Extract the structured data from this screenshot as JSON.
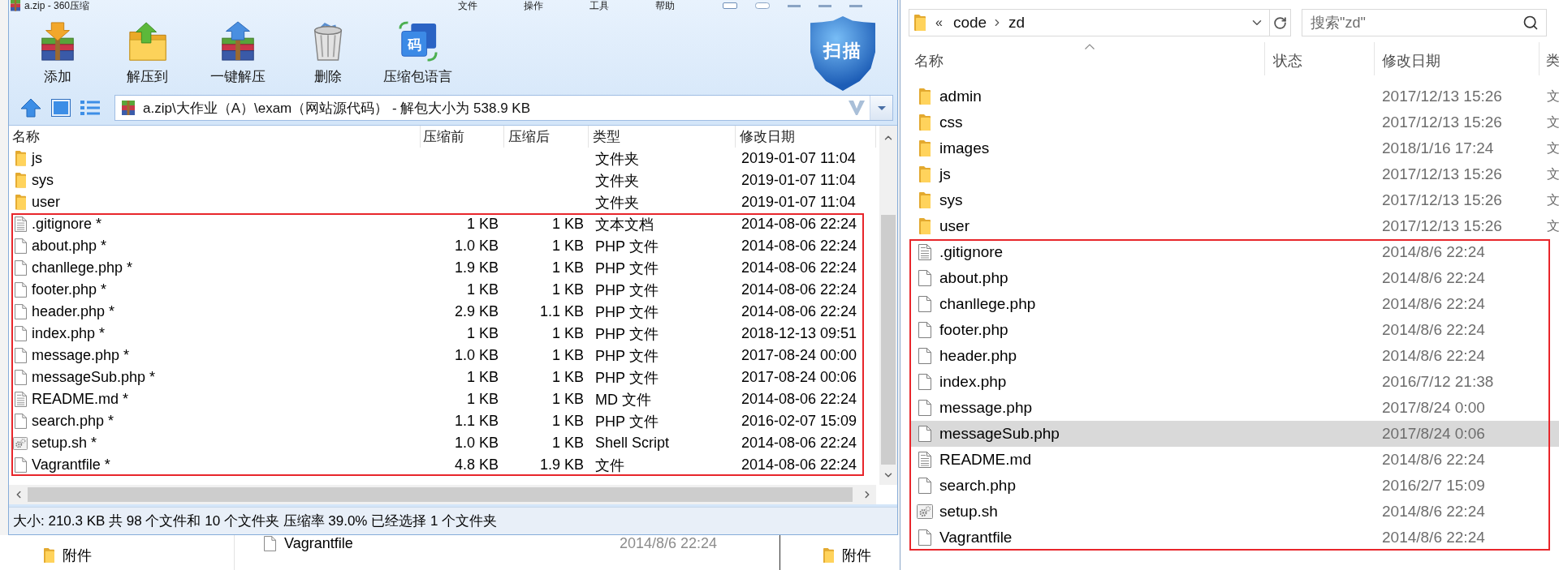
{
  "archive_window": {
    "title": "a.zip - 360压缩",
    "menu": [
      "文件",
      "操作",
      "工具",
      "帮助"
    ],
    "toolbar": [
      {
        "kind": "add",
        "label": "添加"
      },
      {
        "kind": "extract_to",
        "label": "解压到"
      },
      {
        "kind": "quick_extract",
        "label": "一键解压"
      },
      {
        "kind": "delete",
        "label": "删除"
      },
      {
        "kind": "language",
        "label": "压缩包语言",
        "glyph": "码"
      }
    ],
    "scan_button": {
      "label": "扫描"
    },
    "address": "a.zip\\大作业（A）\\exam（网站源代码） - 解包大小为 538.9 KB",
    "columns": [
      "名称",
      "压缩前",
      "压缩后",
      "类型",
      "修改日期"
    ],
    "rows": [
      {
        "kind": "folder",
        "name": "js",
        "type": "文件夹",
        "modified": "2019-01-07 11:04",
        "highlighted": false,
        "selected": false
      },
      {
        "kind": "folder",
        "name": "sys",
        "type": "文件夹",
        "modified": "2019-01-07 11:04",
        "highlighted": false,
        "selected": false
      },
      {
        "kind": "folder",
        "name": "user",
        "type": "文件夹",
        "modified": "2019-01-07 11:04",
        "highlighted": false,
        "selected": false
      },
      {
        "kind": "text",
        "name": ".gitignore *",
        "size": "1 KB",
        "packed": "1 KB",
        "type": "文本文档",
        "modified": "2014-08-06 22:24",
        "highlighted": true,
        "selected": false
      },
      {
        "kind": "file",
        "name": "about.php *",
        "size": "1.0 KB",
        "packed": "1 KB",
        "type": "PHP 文件",
        "modified": "2014-08-06 22:24",
        "highlighted": true,
        "selected": false
      },
      {
        "kind": "file",
        "name": "chanllege.php *",
        "size": "1.9 KB",
        "packed": "1 KB",
        "type": "PHP 文件",
        "modified": "2014-08-06 22:24",
        "highlighted": true,
        "selected": false
      },
      {
        "kind": "file",
        "name": "footer.php *",
        "size": "1 KB",
        "packed": "1 KB",
        "type": "PHP 文件",
        "modified": "2014-08-06 22:24",
        "highlighted": true,
        "selected": false
      },
      {
        "kind": "file",
        "name": "header.php *",
        "size": "2.9 KB",
        "packed": "1.1 KB",
        "type": "PHP 文件",
        "modified": "2014-08-06 22:24",
        "highlighted": true,
        "selected": false
      },
      {
        "kind": "file",
        "name": "index.php *",
        "size": "1 KB",
        "packed": "1 KB",
        "type": "PHP 文件",
        "modified": "2018-12-13 09:51",
        "highlighted": true,
        "selected": false
      },
      {
        "kind": "file",
        "name": "message.php *",
        "size": "1.0 KB",
        "packed": "1 KB",
        "type": "PHP 文件",
        "modified": "2017-08-24 00:00",
        "highlighted": true,
        "selected": false
      },
      {
        "kind": "file",
        "name": "messageSub.php *",
        "size": "1 KB",
        "packed": "1 KB",
        "type": "PHP 文件",
        "modified": "2017-08-24 00:06",
        "highlighted": true,
        "selected": false
      },
      {
        "kind": "text",
        "name": "README.md *",
        "size": "1 KB",
        "packed": "1 KB",
        "type": "MD 文件",
        "modified": "2014-08-06 22:24",
        "highlighted": true,
        "selected": false
      },
      {
        "kind": "file",
        "name": "search.php *",
        "size": "1.1 KB",
        "packed": "1 KB",
        "type": "PHP 文件",
        "modified": "2016-02-07 15:09",
        "highlighted": true,
        "selected": false
      },
      {
        "kind": "script",
        "name": "setup.sh *",
        "size": "1.0 KB",
        "packed": "1 KB",
        "type": "Shell Script",
        "modified": "2014-08-06 22:24",
        "highlighted": true,
        "selected": false
      },
      {
        "kind": "file",
        "name": "Vagrantfile *",
        "size": "4.8 KB",
        "packed": "1.9 KB",
        "type": "文件",
        "modified": "2014-08-06 22:24",
        "highlighted": true,
        "selected": false
      }
    ],
    "status": "大小: 210.3 KB 共 98 个文件和 10 个文件夹 压缩率 39.0% 已经选择 1 个文件夹"
  },
  "background_items": [
    {
      "kind": "folder",
      "name": "附件"
    },
    {
      "kind": "file",
      "name": "Vagrantfile",
      "modified": "2014/8/6 22:24"
    },
    {
      "kind": "folder",
      "name": "附件"
    }
  ],
  "explorer_window": {
    "path_overflow": "«",
    "breadcrumb": [
      "code",
      "zd"
    ],
    "search": {
      "placeholder": "搜索\"zd\""
    },
    "columns": [
      {
        "label": "名称",
        "sorted": true
      },
      {
        "label": "状态",
        "sorted": false
      },
      {
        "label": "修改日期",
        "sorted": false
      },
      {
        "label": "类",
        "sorted": false
      }
    ],
    "rows": [
      {
        "kind": "folder",
        "name": "admin",
        "modified": "2017/12/13 15:26",
        "type": "文",
        "highlighted": false,
        "selected": false
      },
      {
        "kind": "folder",
        "name": "css",
        "modified": "2017/12/13 15:26",
        "type": "文",
        "highlighted": false,
        "selected": false
      },
      {
        "kind": "folder",
        "name": "images",
        "modified": "2018/1/16 17:24",
        "type": "文",
        "highlighted": false,
        "selected": false
      },
      {
        "kind": "folder",
        "name": "js",
        "modified": "2017/12/13 15:26",
        "type": "文",
        "highlighted": false,
        "selected": false
      },
      {
        "kind": "folder",
        "name": "sys",
        "modified": "2017/12/13 15:26",
        "type": "文",
        "highlighted": false,
        "selected": false
      },
      {
        "kind": "folder",
        "name": "user",
        "modified": "2017/12/13 15:26",
        "type": "文",
        "highlighted": false,
        "selected": false
      },
      {
        "kind": "text",
        "name": ".gitignore",
        "modified": "2014/8/6 22:24",
        "highlighted": true,
        "selected": false
      },
      {
        "kind": "file",
        "name": "about.php",
        "modified": "2014/8/6 22:24",
        "highlighted": true,
        "selected": false
      },
      {
        "kind": "file",
        "name": "chanllege.php",
        "modified": "2014/8/6 22:24",
        "highlighted": true,
        "selected": false
      },
      {
        "kind": "file",
        "name": "footer.php",
        "modified": "2014/8/6 22:24",
        "highlighted": true,
        "selected": false
      },
      {
        "kind": "file",
        "name": "header.php",
        "modified": "2014/8/6 22:24",
        "highlighted": true,
        "selected": false
      },
      {
        "kind": "file",
        "name": "index.php",
        "modified": "2016/7/12 21:38",
        "highlighted": true,
        "selected": false
      },
      {
        "kind": "file",
        "name": "message.php",
        "modified": "2017/8/24 0:00",
        "highlighted": true,
        "selected": false
      },
      {
        "kind": "file",
        "name": "messageSub.php",
        "modified": "2017/8/24 0:06",
        "highlighted": true,
        "selected": true
      },
      {
        "kind": "text",
        "name": "README.md",
        "modified": "2014/8/6 22:24",
        "highlighted": true,
        "selected": false
      },
      {
        "kind": "file",
        "name": "search.php",
        "modified": "2016/2/7 15:09",
        "highlighted": true,
        "selected": false
      },
      {
        "kind": "script",
        "name": "setup.sh",
        "modified": "2014/8/6 22:24",
        "highlighted": true,
        "selected": false
      },
      {
        "kind": "file",
        "name": "Vagrantfile",
        "modified": "2014/8/6 22:24",
        "highlighted": true,
        "selected": false
      }
    ]
  }
}
